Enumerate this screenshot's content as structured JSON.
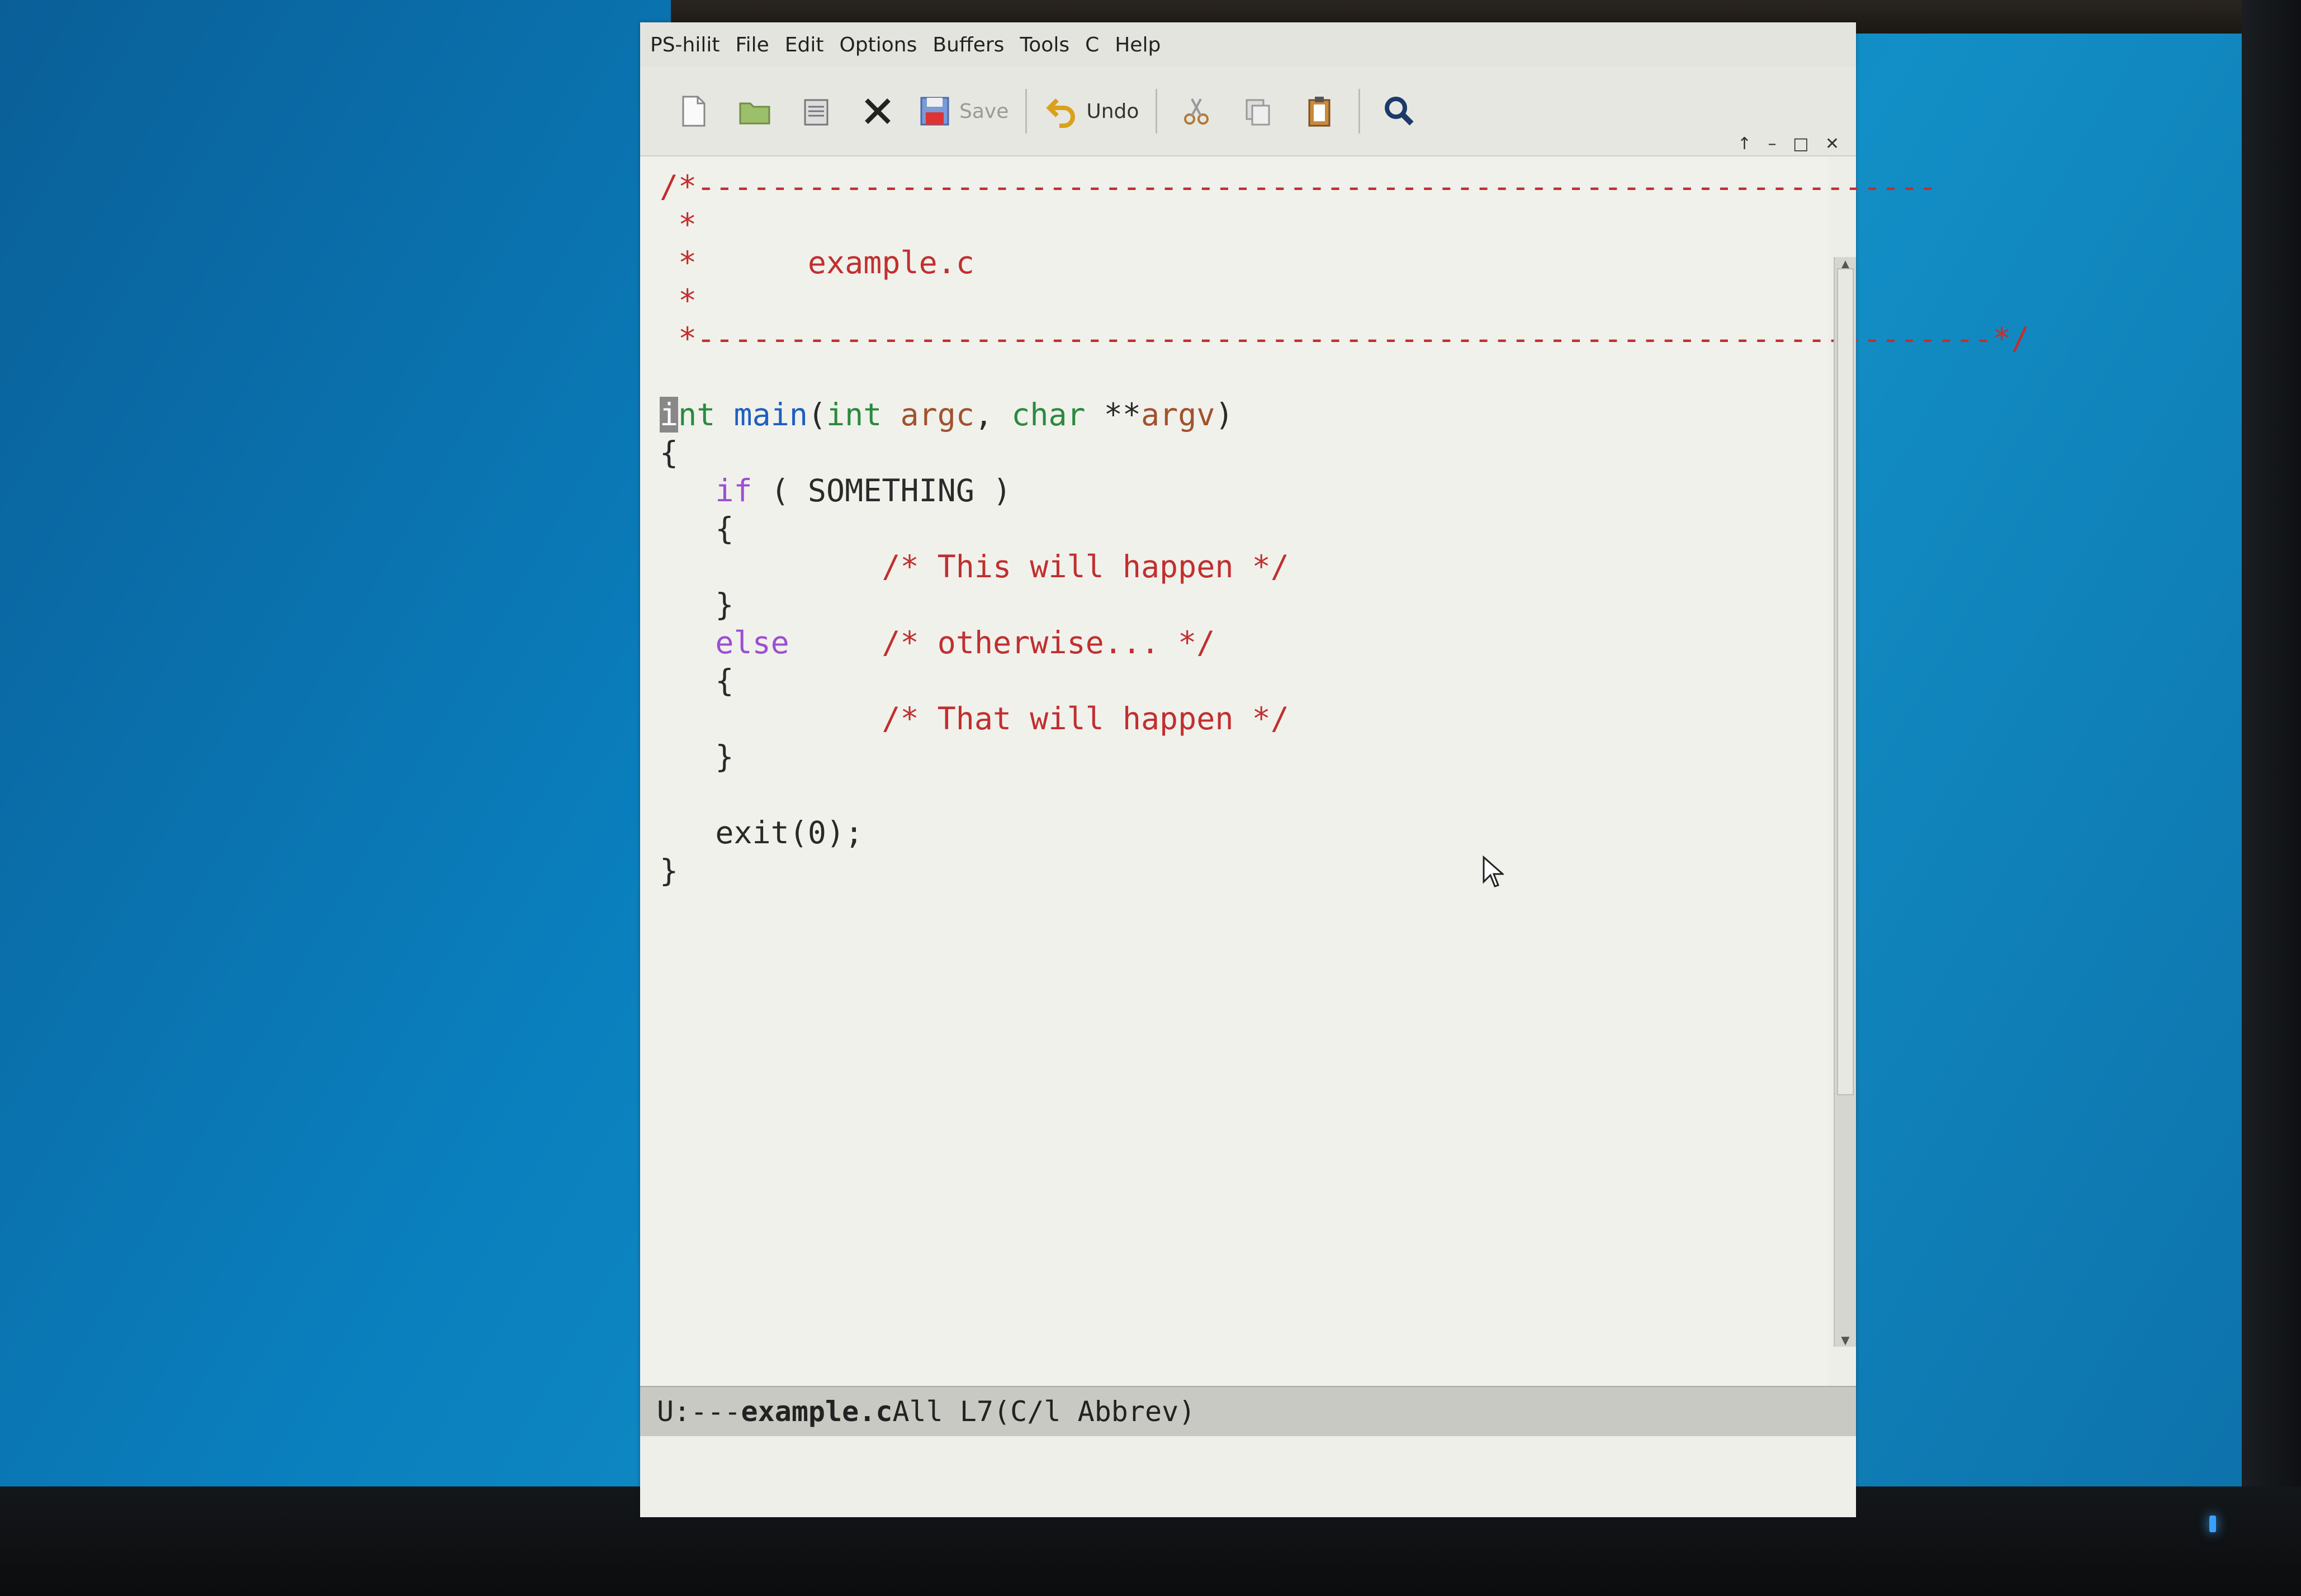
{
  "menubar": {
    "items": [
      "PS-hilit",
      "File",
      "Edit",
      "Options",
      "Buffers",
      "Tools",
      "C",
      "Help"
    ]
  },
  "window_controls": "↑ – □ ✕",
  "toolbar": {
    "save_label": "Save",
    "undo_label": "Undo"
  },
  "editor": {
    "filename_comment": "example.c",
    "lines": {
      "l1": "/*-------------------------------------------------------------------",
      "l2": " *",
      "l3": " *",
      "l4": " *",
      "l5": " *----------------------------------------------------------------------*/",
      "if_cond": " ( SOMETHING )",
      "comment_this": "/* This will happen */",
      "comment_otherwise": "/* otherwise... */",
      "comment_that": "/* That will happen */",
      "exit_stmt": "exit(0);"
    }
  },
  "modeline": {
    "status": "U:---",
    "buffer": "example.c",
    "position": "All L7",
    "mode": "(C/l Abbrev)"
  },
  "colors": {
    "comment": "#c0302f",
    "type": "#2a8a3e",
    "function": "#1f5fbf",
    "keyword": "#9b4fd0",
    "variable": "#a0522d"
  }
}
